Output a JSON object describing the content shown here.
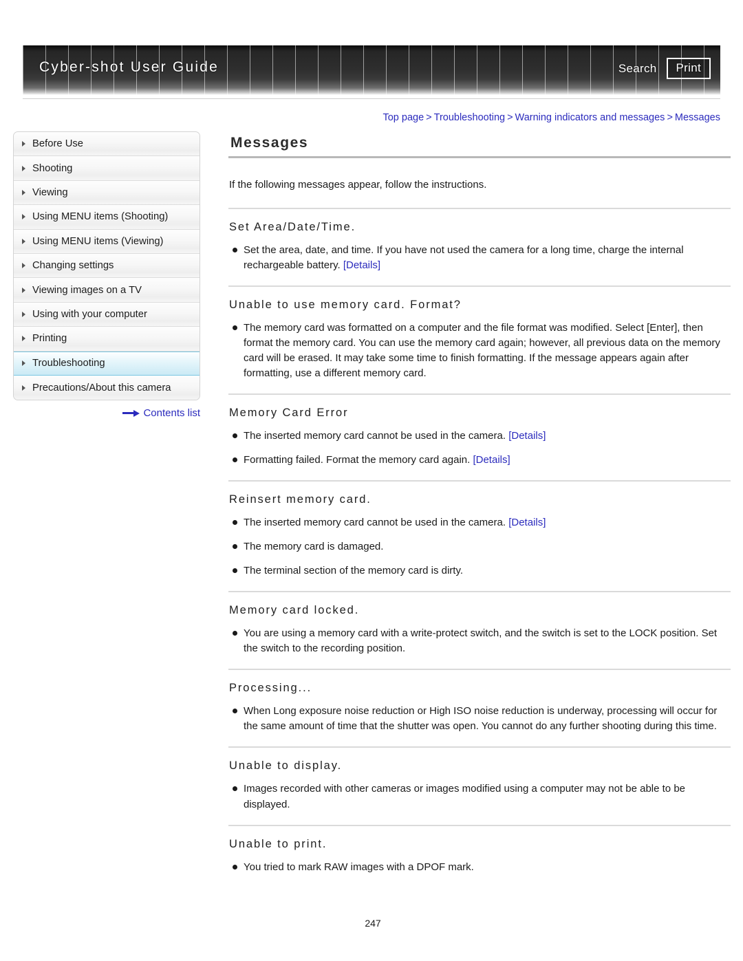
{
  "header": {
    "title": "Cyber-shot User Guide",
    "search_label": "Search",
    "print_label": "Print"
  },
  "breadcrumb": {
    "items": [
      "Top page",
      "Troubleshooting",
      "Warning indicators and messages",
      "Messages"
    ],
    "separator": ">"
  },
  "sidebar": {
    "items": [
      {
        "label": "Before Use",
        "active": false
      },
      {
        "label": "Shooting",
        "active": false
      },
      {
        "label": "Viewing",
        "active": false
      },
      {
        "label": "Using MENU items (Shooting)",
        "active": false
      },
      {
        "label": "Using MENU items (Viewing)",
        "active": false
      },
      {
        "label": "Changing settings",
        "active": false
      },
      {
        "label": "Viewing images on a TV",
        "active": false
      },
      {
        "label": "Using with your computer",
        "active": false
      },
      {
        "label": "Printing",
        "active": false
      },
      {
        "label": "Troubleshooting",
        "active": true
      },
      {
        "label": "Precautions/About this camera",
        "active": false
      }
    ],
    "contents_list_label": "Contents list"
  },
  "main": {
    "title": "Messages",
    "intro": "If the following messages appear, follow the instructions.",
    "sections": [
      {
        "heading": "Set Area/Date/Time.",
        "bullets": [
          {
            "text": "Set the area, date, and time. If you have not used the camera for a long time, charge the internal rechargeable battery. ",
            "link": "[Details]"
          }
        ]
      },
      {
        "heading": "Unable to use memory card. Format?",
        "bullets": [
          {
            "text": "The memory card was formatted on a computer and the file format was modified. Select [Enter], then format the memory card. You can use the memory card again; however, all previous data on the memory card will be erased. It may take some time to finish formatting. If the message appears again after formatting, use a different memory card.",
            "link": ""
          }
        ]
      },
      {
        "heading": "Memory Card Error",
        "bullets": [
          {
            "text": "The inserted memory card cannot be used in the camera. ",
            "link": "[Details]"
          },
          {
            "text": "Formatting failed. Format the memory card again. ",
            "link": "[Details]"
          }
        ]
      },
      {
        "heading": "Reinsert memory card.",
        "bullets": [
          {
            "text": "The inserted memory card cannot be used in the camera. ",
            "link": "[Details]"
          },
          {
            "text": "The memory card is damaged.",
            "link": ""
          },
          {
            "text": "The terminal section of the memory card is dirty.",
            "link": ""
          }
        ]
      },
      {
        "heading": "Memory card locked.",
        "bullets": [
          {
            "text": "You are using a memory card with a write-protect switch, and the switch is set to the LOCK position. Set the switch to the recording position.",
            "link": ""
          }
        ]
      },
      {
        "heading": "Processing...",
        "bullets": [
          {
            "text": "When Long exposure noise reduction or High ISO noise reduction is underway, processing will occur for the same amount of time that the shutter was open. You cannot do any further shooting during this time.",
            "link": ""
          }
        ]
      },
      {
        "heading": "Unable to display.",
        "bullets": [
          {
            "text": "Images recorded with other cameras or images modified using a computer may not be able to be displayed.",
            "link": ""
          }
        ]
      },
      {
        "heading": "Unable to print.",
        "bullets": [
          {
            "text": "You tried to mark RAW images with a DPOF mark.",
            "link": ""
          }
        ]
      }
    ],
    "page_number": "247"
  },
  "colors": {
    "link": "#2b2bbd",
    "active_nav": "#cbeaf5",
    "header_bg": "#2e2e2e"
  }
}
